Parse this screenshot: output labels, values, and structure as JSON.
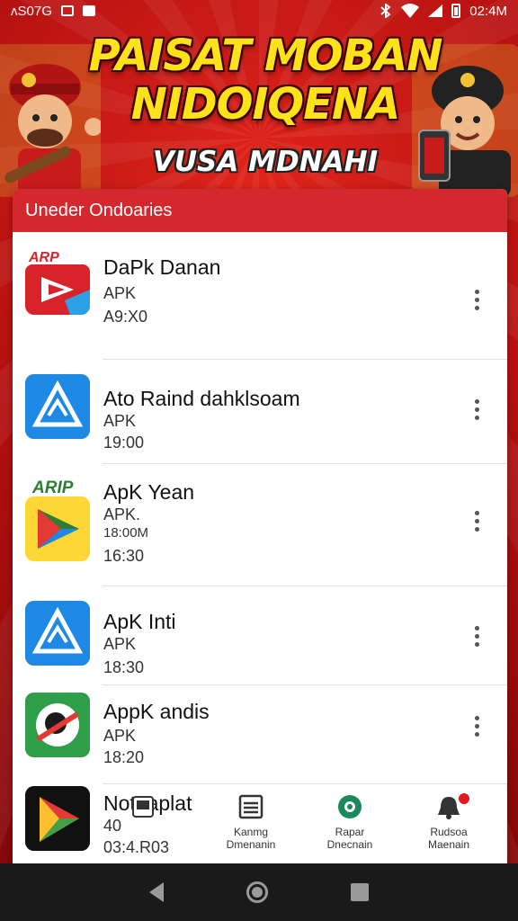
{
  "status_bar": {
    "left_text": "ʌS07G",
    "time": "02:4M"
  },
  "banner": {
    "title_line1": "PAISAT MOBAN",
    "title_line2": "NIDOIQENA",
    "subtitle": "VUSA MDNAHI"
  },
  "list": {
    "header": "Uneder Ondoaries",
    "apps": [
      {
        "name": "DaPk Danan",
        "line1": "APK",
        "line2": "A9:X0",
        "icon": "red-play-logo-icon",
        "icon_badge": "ARP"
      },
      {
        "name": "Ato Raind dahklsoam",
        "line1": "APK",
        "line2": "19:00",
        "icon": "blue-triangle-logo-icon"
      },
      {
        "name": "ApK Yean",
        "line1": "APK.",
        "line2": "18:00M",
        "line3": "16:30",
        "icon": "yellow-play-logo-icon",
        "icon_badge": "ARIP"
      },
      {
        "name": "ApK Inti",
        "line1": "APK",
        "line2": "18:30",
        "icon": "blue-triangle-logo-icon"
      },
      {
        "name": "AppK andis",
        "line1": "APK",
        "line2": "18:20",
        "icon": "green-circle-logo-icon"
      },
      {
        "name": "Noteaplat",
        "line1": "40",
        "line2": "03:4.R03",
        "icon": "dark-play-logo-icon"
      }
    ]
  },
  "bottom_nav": [
    {
      "line1": "Kanmg",
      "line2": "Dmenanin",
      "icon": "list-icon"
    },
    {
      "line1": "Rapar",
      "line2": "Dnecnain",
      "icon": "gear-icon"
    },
    {
      "line1": "Rudsoa",
      "line2": "Maenain",
      "icon": "bell-icon"
    }
  ],
  "colors": {
    "accent_red": "#d3282d",
    "banner_yellow": "#ffe21a"
  }
}
